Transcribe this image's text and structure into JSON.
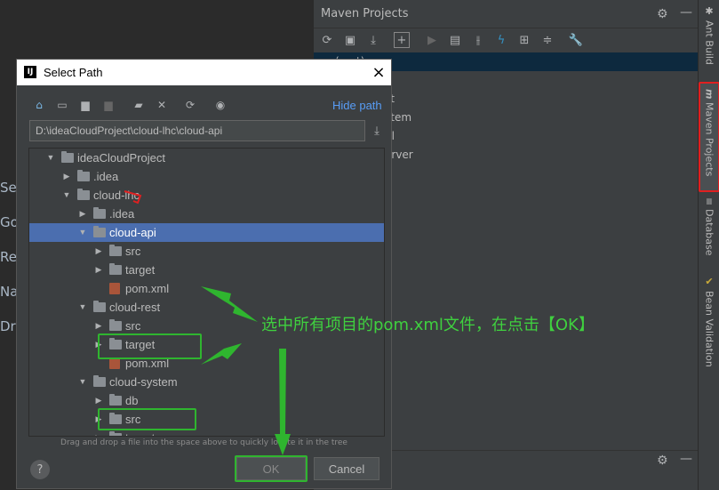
{
  "ide_left": {
    "labels": [
      "Se",
      "Go",
      "Re",
      "Na",
      "Dr"
    ]
  },
  "maven_panel": {
    "title": "Maven Projects",
    "tree": [
      "(root)",
      "i",
      "st",
      "stem",
      "ul",
      "erver"
    ]
  },
  "right_stripe": {
    "tabs": [
      "Ant Build",
      "Maven Projects",
      "Database",
      "Bean Validation"
    ]
  },
  "dialog": {
    "title": "Select Path",
    "logo_text": "IJ",
    "hide_path_label": "Hide path",
    "path_value": "D:\\ideaCloudProject\\cloud-lhc\\cloud-api",
    "tree": [
      {
        "label": "ideaCloudProject",
        "level": 0,
        "expanded": true,
        "kind": "folder"
      },
      {
        "label": ".idea",
        "level": 1,
        "expanded": false,
        "kind": "folder"
      },
      {
        "label": "cloud-lhc",
        "level": 1,
        "expanded": true,
        "kind": "folder"
      },
      {
        "label": ".idea",
        "level": 2,
        "expanded": false,
        "kind": "folder"
      },
      {
        "label": "cloud-api",
        "level": 2,
        "expanded": true,
        "kind": "folder",
        "selected": true
      },
      {
        "label": "src",
        "level": 3,
        "expanded": false,
        "kind": "folder"
      },
      {
        "label": "target",
        "level": 3,
        "expanded": false,
        "kind": "folder"
      },
      {
        "label": "pom.xml",
        "level": 3,
        "kind": "pom",
        "highlighted": true
      },
      {
        "label": "cloud-rest",
        "level": 2,
        "expanded": true,
        "kind": "folder"
      },
      {
        "label": "src",
        "level": 3,
        "expanded": false,
        "kind": "folder"
      },
      {
        "label": "target",
        "level": 3,
        "expanded": false,
        "kind": "folder"
      },
      {
        "label": "pom.xml",
        "level": 3,
        "kind": "pom",
        "highlighted": true
      },
      {
        "label": "cloud-system",
        "level": 2,
        "expanded": true,
        "kind": "folder"
      },
      {
        "label": "db",
        "level": 3,
        "expanded": false,
        "kind": "folder"
      },
      {
        "label": "src",
        "level": 3,
        "expanded": false,
        "kind": "folder"
      },
      {
        "label": "target",
        "level": 3,
        "expanded": false,
        "kind": "folder"
      }
    ],
    "dnd_hint": "Drag and drop a file into the space above to quickly locate it in the tree",
    "ok_label": "OK",
    "cancel_label": "Cancel",
    "help_label": "?"
  },
  "annotation": "选中所有项目的pom.xml文件，在点击【OK】",
  "colors": {
    "accent": "#4b6eaf",
    "link": "#589df6",
    "annotation": "#2fb52f",
    "highlight_red": "#e02020"
  },
  "icons": {
    "close": "×",
    "expanded": "▼",
    "collapsed": "▶"
  }
}
